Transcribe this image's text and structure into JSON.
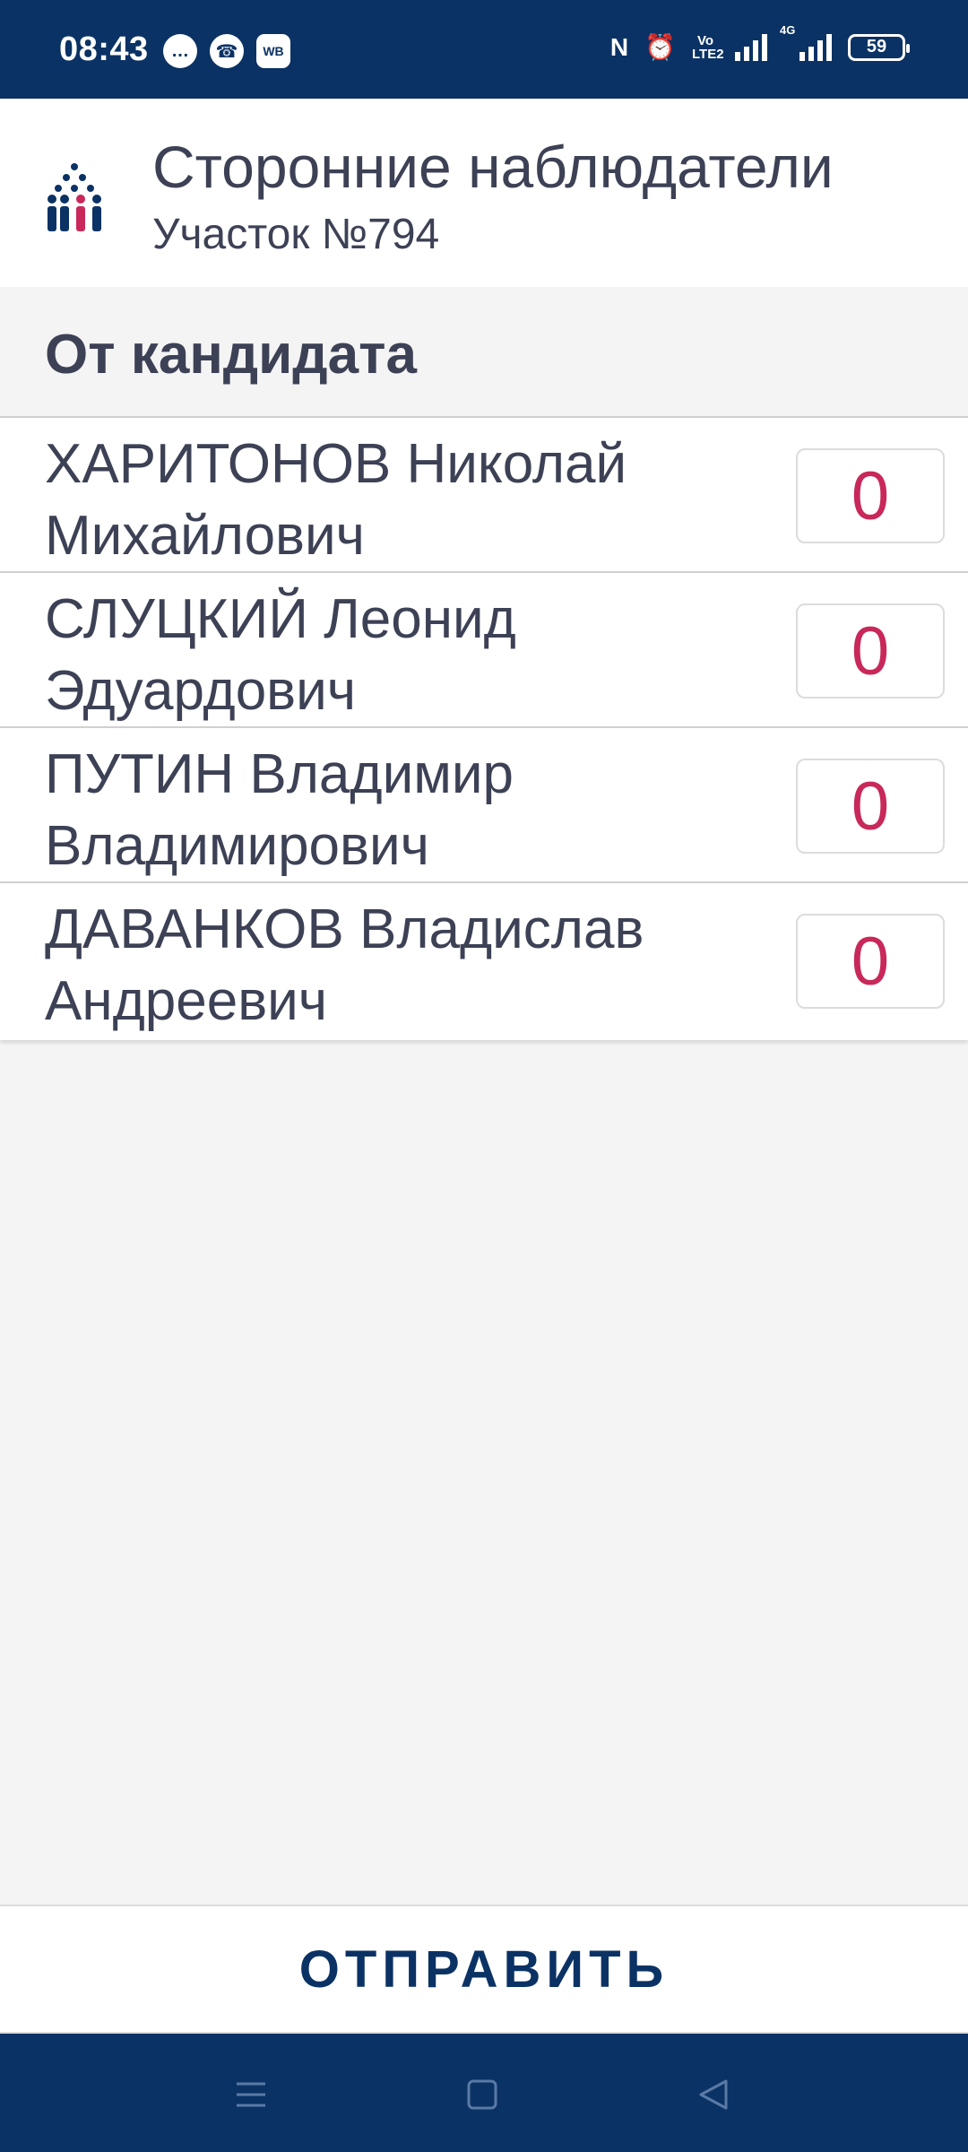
{
  "status_bar": {
    "time": "08:43",
    "notifications": [
      {
        "icon": "chat-bubble-icon",
        "glyph": "…"
      },
      {
        "icon": "viber-icon",
        "glyph": "☎"
      },
      {
        "icon": "wb-icon",
        "text": "WB"
      }
    ],
    "indicators": [
      "nfc-icon",
      "alarm-icon",
      "volte-icon",
      "signal-icon",
      "4g-signal-icon"
    ],
    "volte_text": "Vo LTE2",
    "network_text": "4G",
    "battery": "59"
  },
  "app_bar": {
    "logo": "people-group-logo",
    "title": "Сторонние наблюдатели",
    "subtitle": "Участок №794"
  },
  "section": {
    "label": "От кандидата"
  },
  "candidates": [
    {
      "name": "ХАРИТОНОВ Николай Михайлович",
      "count": "0"
    },
    {
      "name": "СЛУЦКИЙ Леонид Эдуардович",
      "count": "0"
    },
    {
      "name": "ПУТИН Владимир Владимирович",
      "count": "0"
    },
    {
      "name": "ДАВАНКОВ Владислав Андреевич",
      "count": "0"
    }
  ],
  "submit_label": "ОТПРАВИТЬ",
  "nav_bar": [
    "menu-icon",
    "home-square-icon",
    "back-triangle-icon"
  ],
  "colors": {
    "primary": "#0b3264",
    "accent": "#c8285a",
    "text": "#3d4155",
    "background": "#f4f4f4"
  }
}
